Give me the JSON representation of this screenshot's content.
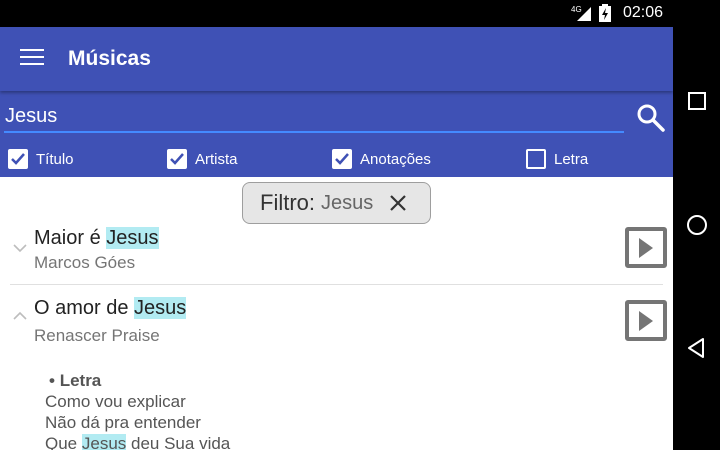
{
  "status": {
    "network": "4G",
    "time": "02:06"
  },
  "toolbar": {
    "title": "Músicas"
  },
  "search": {
    "query": "Jesus"
  },
  "filters": [
    {
      "label": "Título",
      "checked": true
    },
    {
      "label": "Artista",
      "checked": true
    },
    {
      "label": "Anotações",
      "checked": true
    },
    {
      "label": "Letra",
      "checked": false
    }
  ],
  "chip": {
    "label": "Filtro:",
    "value": "Jesus"
  },
  "songs": [
    {
      "title_before": "Maior é ",
      "title_highlight": "Jesus",
      "title_after": "",
      "artist": "Marcos Góes"
    },
    {
      "title_before": "O amor de ",
      "title_highlight": "Jesus",
      "title_after": "",
      "artist": "Renascer Praise"
    }
  ],
  "lyrics": {
    "heading": "Letra",
    "lines": [
      "Como vou explicar",
      "Não dá pra entender"
    ],
    "last_line_before": "Que ",
    "last_line_highlight": "Jesus",
    "last_line_after": " deu Sua vida"
  },
  "colors": {
    "primary": "#3f51b5",
    "accent": "#448aff",
    "highlight": "#b2ebf2"
  }
}
